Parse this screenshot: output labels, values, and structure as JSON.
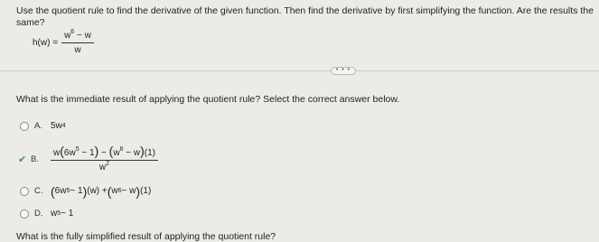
{
  "instructions": "Use the quotient rule to find the derivative of the given function. Then find the derivative by first simplifying the function. Are the results the same?",
  "function": {
    "lhs": "h(w) =",
    "numerator": "w⁶ − w",
    "denominator": "w"
  },
  "more_button": "• • •",
  "question": "What is the immediate result of applying the quotient rule? Select the correct answer below.",
  "options": [
    {
      "letter": "A.",
      "selected": false
    },
    {
      "letter": "B.",
      "selected": true,
      "correct_mark": "✔"
    },
    {
      "letter": "C.",
      "selected": false
    },
    {
      "letter": "D.",
      "selected": false
    }
  ],
  "question2": "What is the fully simplified result of applying the quotient rule?",
  "colors": {
    "check": "#3b9a3b",
    "background": "#ecebe8"
  }
}
